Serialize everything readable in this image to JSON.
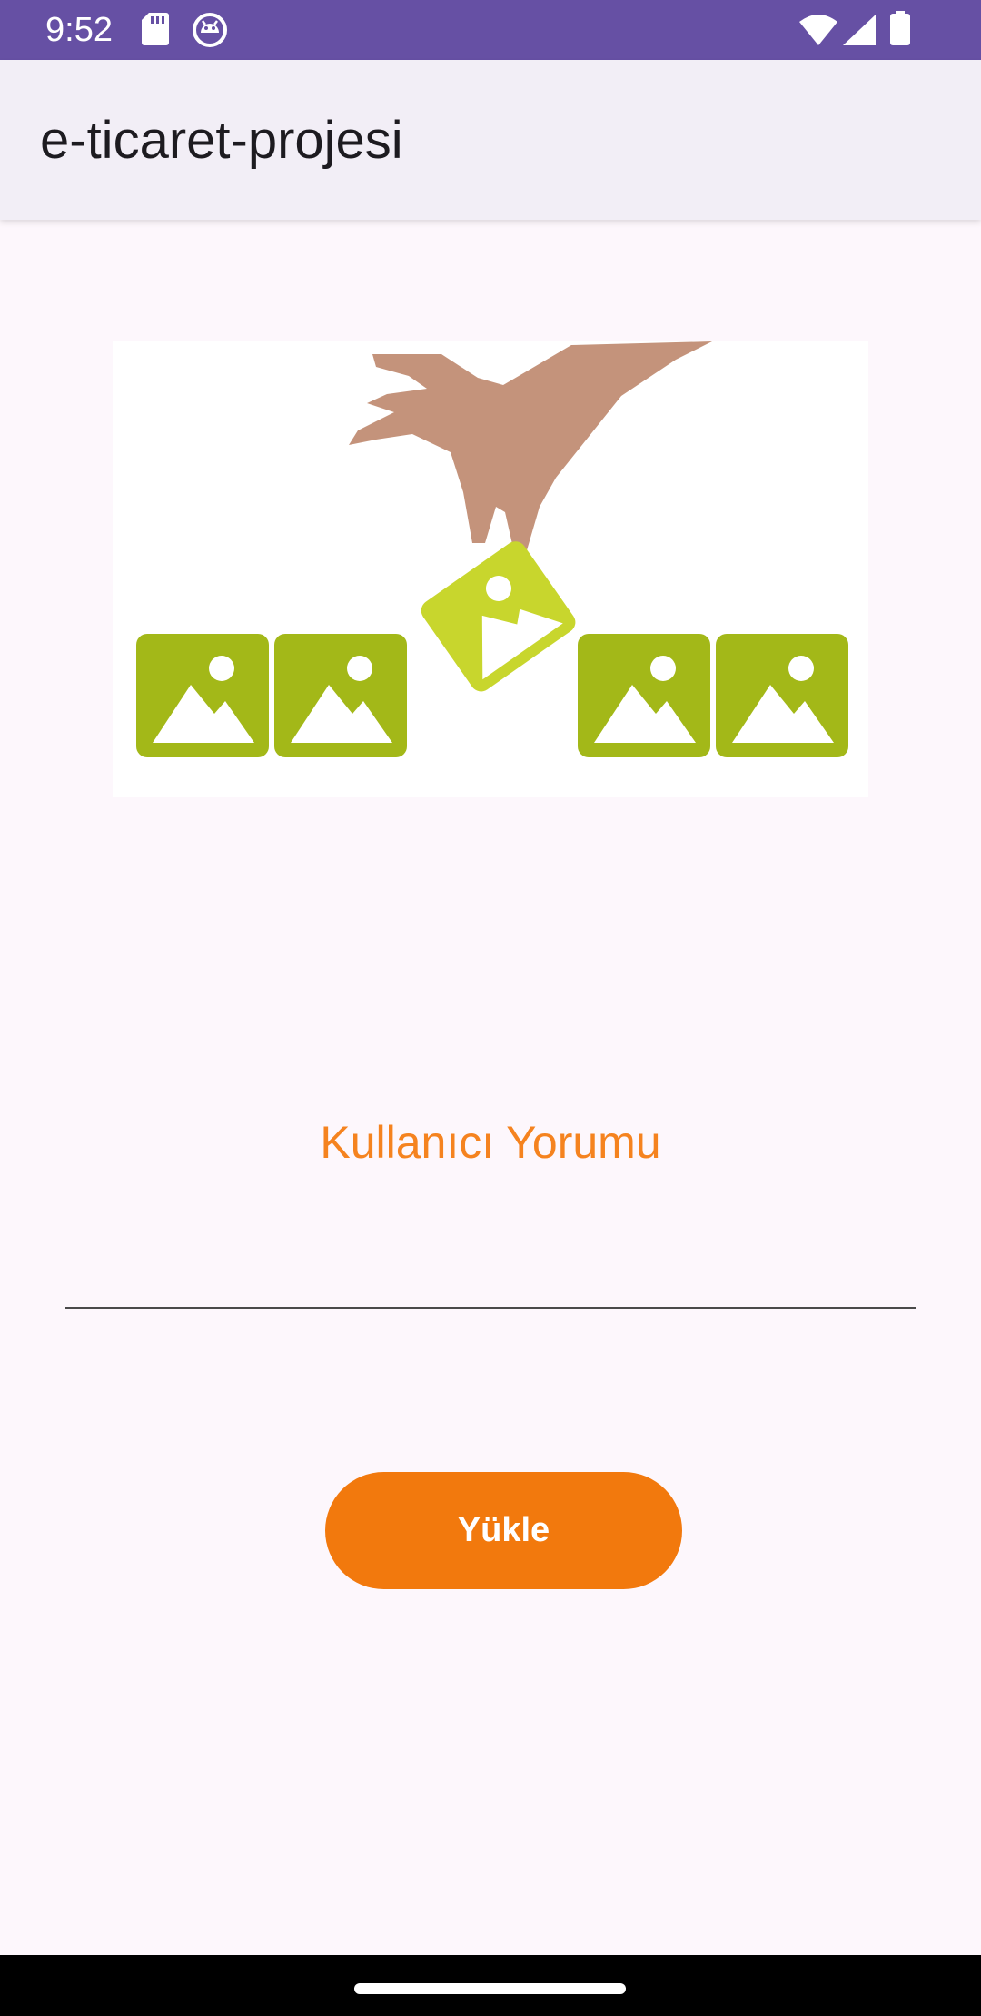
{
  "status_bar": {
    "time": "9:52",
    "icons_left": [
      "sd-card-icon",
      "android-debug-icon"
    ],
    "icons_right": [
      "wifi-icon",
      "cell-signal-icon",
      "battery-icon"
    ],
    "color": "#6650a4"
  },
  "app_bar": {
    "title": "e-ticaret-projesi"
  },
  "main": {
    "image_icon": "image-gallery-upload-illustration",
    "comment_label": "Kullanıcı Yorumu",
    "comment_input_value": "",
    "upload_button_label": "Yükle"
  },
  "colors": {
    "accent": "#f5831f",
    "button": "#f2790d",
    "background": "#fdf7fc",
    "app_bar": "#f2eef6"
  }
}
